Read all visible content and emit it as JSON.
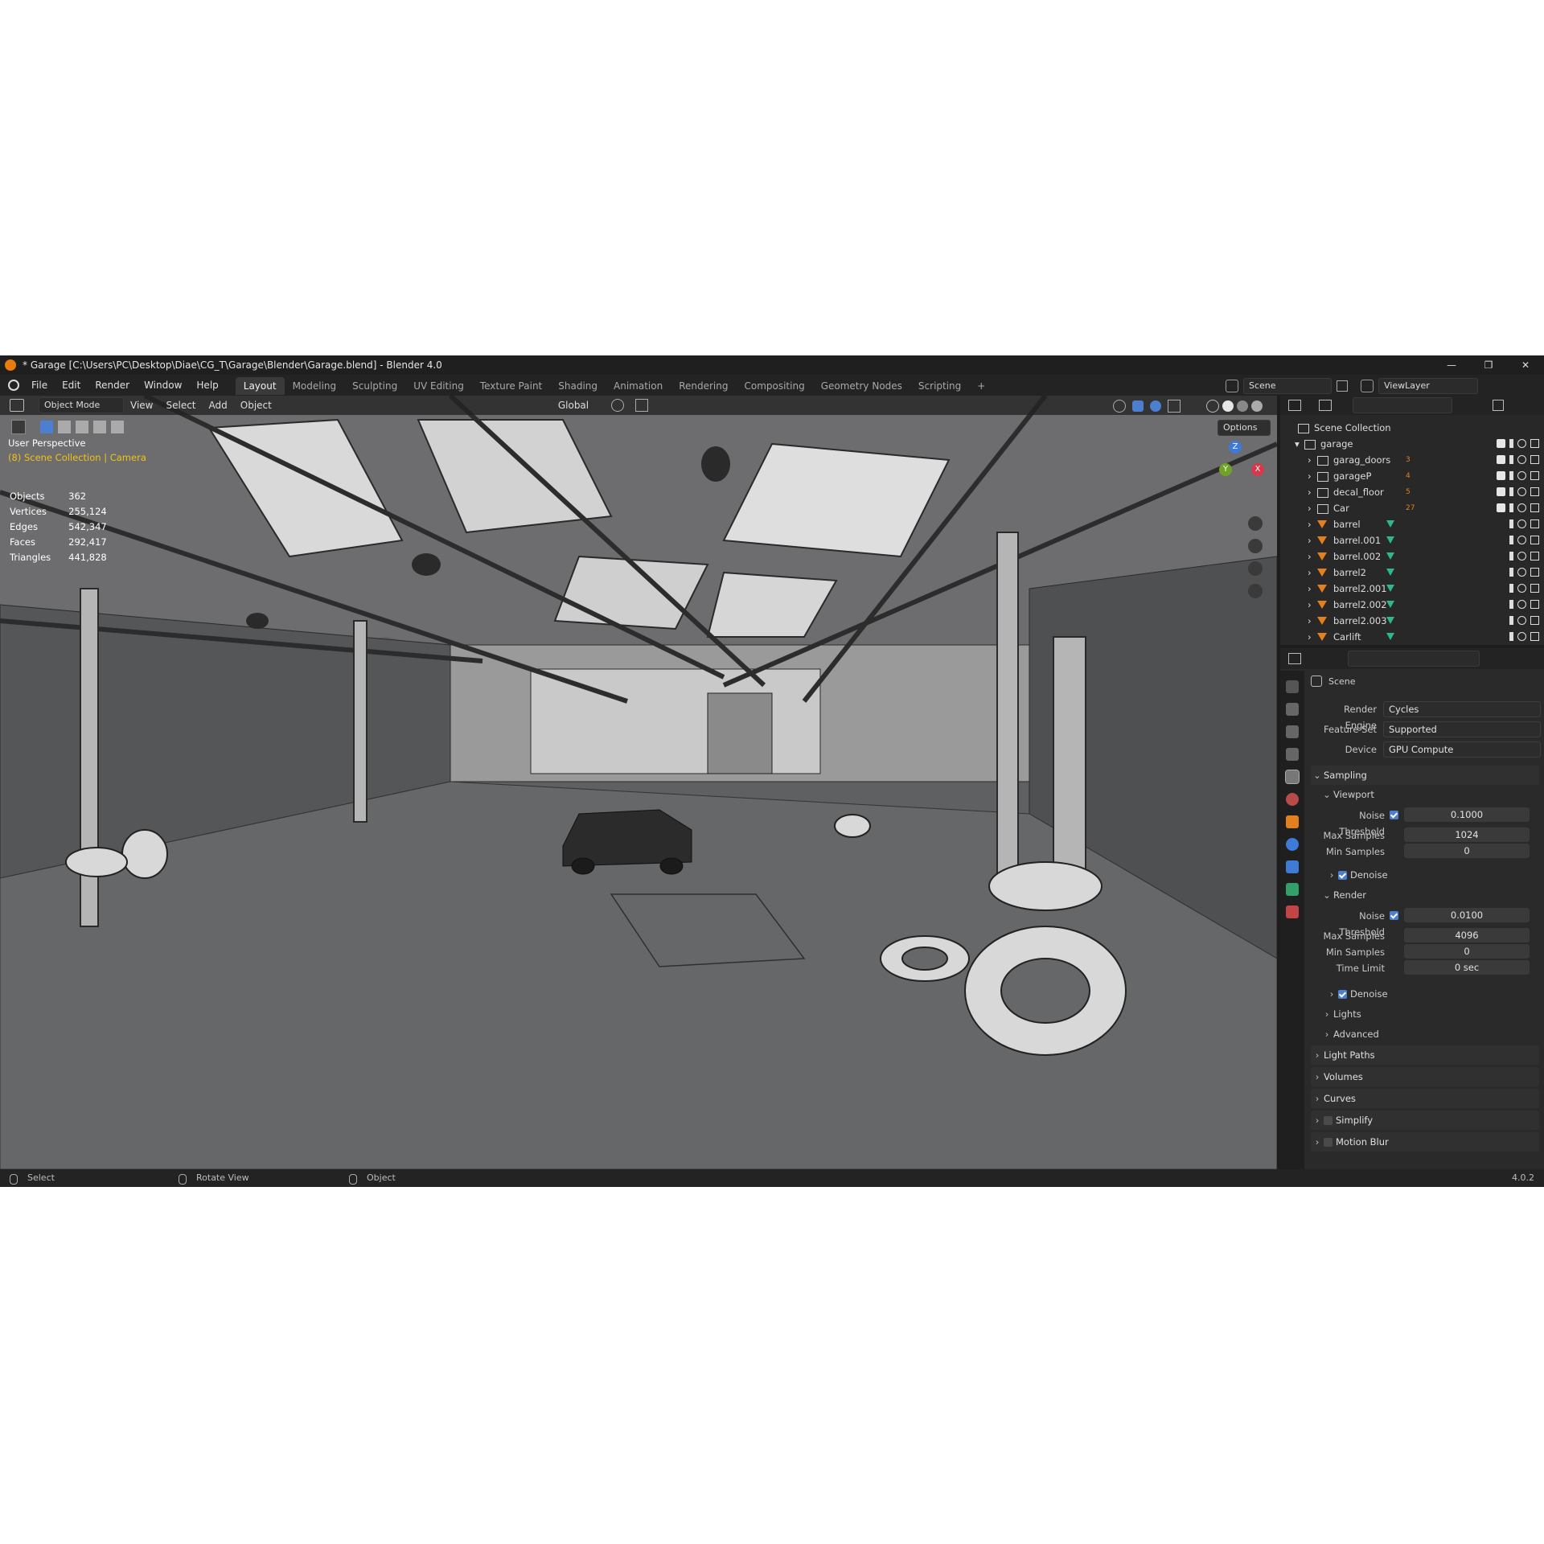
{
  "window": {
    "title": "* Garage [C:\\Users\\PC\\Desktop\\Diae\\CG_T\\Garage\\Blender\\Garage.blend] - Blender 4.0",
    "controls": [
      "—",
      "❐",
      "✕"
    ]
  },
  "menu": [
    "File",
    "Edit",
    "Render",
    "Window",
    "Help"
  ],
  "workspaces": [
    "Layout",
    "Modeling",
    "Sculpting",
    "UV Editing",
    "Texture Paint",
    "Shading",
    "Animation",
    "Rendering",
    "Compositing",
    "Geometry Nodes",
    "Scripting",
    "+"
  ],
  "active_workspace": "Layout",
  "scene_name": "Scene",
  "view_layer": "ViewLayer",
  "viewport": {
    "mode": "Object Mode",
    "menus": [
      "View",
      "Select",
      "Add",
      "Object"
    ],
    "orientation": "Global",
    "options_label": "Options",
    "perspective": "User Perspective",
    "collection_text": "(8) Scene Collection | Camera",
    "stats": [
      {
        "label": "Objects",
        "value": "362"
      },
      {
        "label": "Vertices",
        "value": "255,124"
      },
      {
        "label": "Edges",
        "value": "542,347"
      },
      {
        "label": "Faces",
        "value": "292,417"
      },
      {
        "label": "Triangles",
        "value": "441,828"
      }
    ],
    "gizmo": {
      "x": "X",
      "y": "Y",
      "z": "Z"
    }
  },
  "outliner": {
    "root": "Scene Collection",
    "items": [
      {
        "name": "garage",
        "count": ""
      },
      {
        "name": "garag_doors",
        "count": "3"
      },
      {
        "name": "garageP",
        "count": "4"
      },
      {
        "name": "decal_floor",
        "count": "5"
      },
      {
        "name": "Car",
        "count": "27"
      },
      {
        "name": "barrel",
        "count": ""
      },
      {
        "name": "barrel.001",
        "count": ""
      },
      {
        "name": "barrel.002",
        "count": ""
      },
      {
        "name": "barrel2",
        "count": ""
      },
      {
        "name": "barrel2.001",
        "count": ""
      },
      {
        "name": "barrel2.002",
        "count": ""
      },
      {
        "name": "barrel2.003",
        "count": ""
      },
      {
        "name": "Carlift",
        "count": ""
      }
    ]
  },
  "properties": {
    "context": "Scene",
    "render_engine_label": "Render Engine",
    "render_engine": "Cycles",
    "feature_set_label": "Feature Set",
    "feature_set": "Supported",
    "device_label": "Device",
    "device": "GPU Compute",
    "sampling": "Sampling",
    "viewport_sub": "Viewport",
    "noise_threshold_label": "Noise Threshold",
    "viewport_noise": "0.1000",
    "max_samples_label": "Max Samples",
    "viewport_max": "1024",
    "min_samples_label": "Min Samples",
    "viewport_min": "0",
    "denoise_label": "Denoise",
    "render_sub": "Render",
    "render_noise": "0.0100",
    "render_max": "4096",
    "render_min": "0",
    "time_limit_label": "Time Limit",
    "time_limit": "0 sec",
    "lights": "Lights",
    "advanced": "Advanced",
    "light_paths": "Light Paths",
    "volumes": "Volumes",
    "curves": "Curves",
    "simplify": "Simplify",
    "motion_blur": "Motion Blur"
  },
  "statusbar": {
    "select": "Select",
    "rotate": "Rotate View",
    "object": "Object",
    "version": "4.0.2"
  }
}
